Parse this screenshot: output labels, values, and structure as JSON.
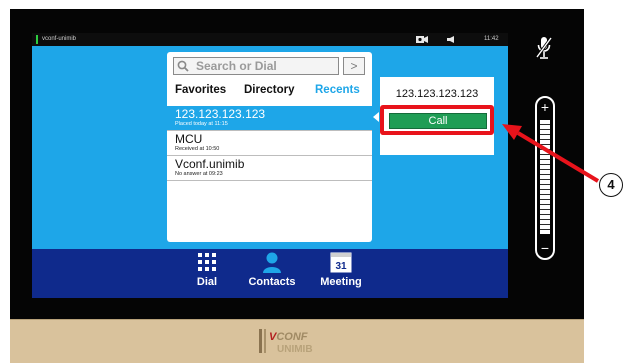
{
  "statusbar": {
    "device_name": "vconf-unimib",
    "time": "11:42"
  },
  "search": {
    "placeholder": "Search or Dial",
    "go_symbol": ">"
  },
  "tabs": [
    {
      "label": "Favorites"
    },
    {
      "label": "Directory"
    },
    {
      "label": "Recents",
      "active": true
    }
  ],
  "recents": [
    {
      "title": "123.123.123.123",
      "subtitle": "Placed today at 11:15",
      "selected": true
    },
    {
      "title": "MCU",
      "subtitle": "Received at 10:50"
    },
    {
      "title": "Vconf.unimib",
      "subtitle": "No answer at 09:23"
    }
  ],
  "call_panel": {
    "number": "123.123.123.123",
    "call_label": "Call"
  },
  "bottom_nav": {
    "dial": "Dial",
    "contacts": "Contacts",
    "meeting": "Meeting",
    "meeting_day": "31"
  },
  "volume": {
    "plus": "+",
    "minus": "−",
    "level": 1.0
  },
  "annotation": {
    "callout": "4"
  },
  "logo": {
    "line1": "VCONF",
    "line2": "UNIMIB"
  },
  "colors": {
    "screen_bg": "#1ea6e8",
    "nav_bar": "#0f2a8c",
    "call_button": "#1f9d55",
    "highlight_red": "#e8131b",
    "base": "#d9c29c"
  },
  "icons": [
    "camera-icon",
    "speaker-icon",
    "search-icon",
    "dialpad-icon",
    "contacts-icon",
    "calendar-icon",
    "mic-muted-icon",
    "volume-slider",
    "annotation-arrow"
  ]
}
